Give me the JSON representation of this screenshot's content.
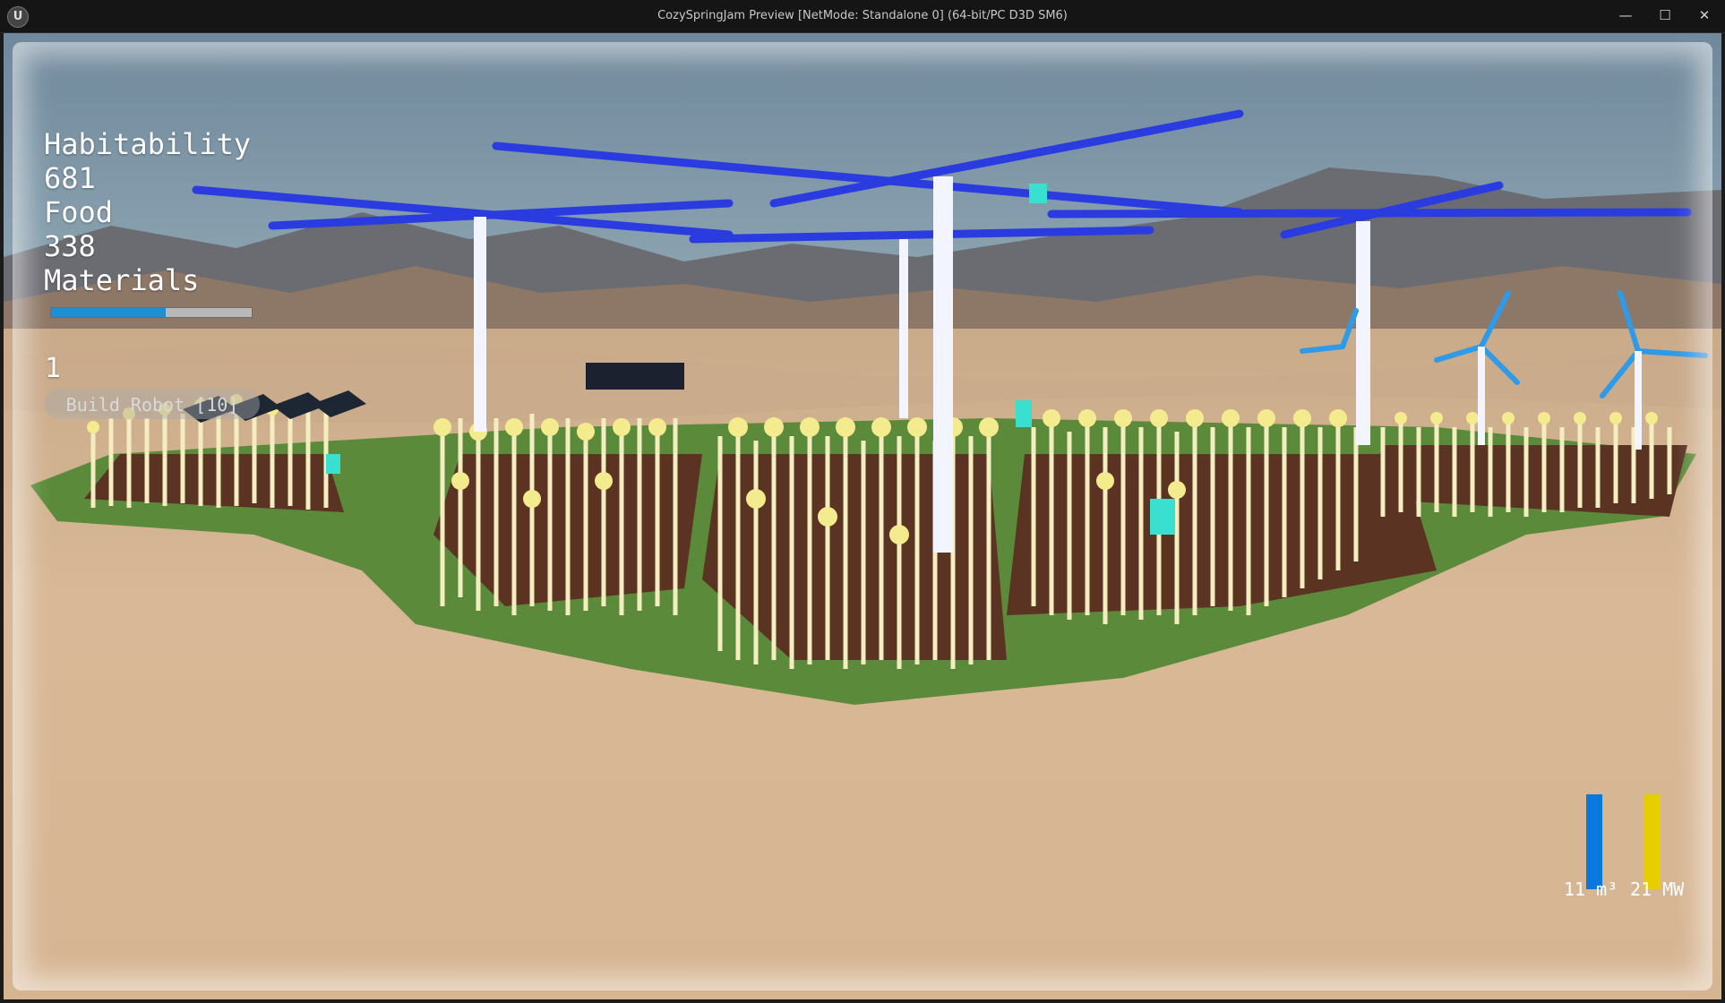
{
  "window": {
    "title": "CozySpringJam Preview [NetMode: Standalone 0]  (64-bit/PC D3D SM6)",
    "app_icon": "U",
    "minimize_icon": "—",
    "maximize_icon": "☐",
    "close_icon": "✕"
  },
  "hud": {
    "habitability_label": "Habitability",
    "habitability_value": "681",
    "food_label": "Food",
    "food_value": "338",
    "materials_label": "Materials",
    "materials_progress": 0.57,
    "robot_count": "1",
    "build_robot_label": "Build Robot [10]"
  },
  "resources": {
    "water_label": "11 m³",
    "water_level": 1.0,
    "power_label": "21 MW",
    "power_level": 1.0
  },
  "colors": {
    "sky": "#7790a3",
    "sand": "#d2af8a",
    "grass": "#5b8a3a",
    "soil": "#5a3322",
    "turbine_blue": "#2a3ce0",
    "water_gauge": "#0b78e0",
    "power_gauge": "#e5cf00"
  }
}
